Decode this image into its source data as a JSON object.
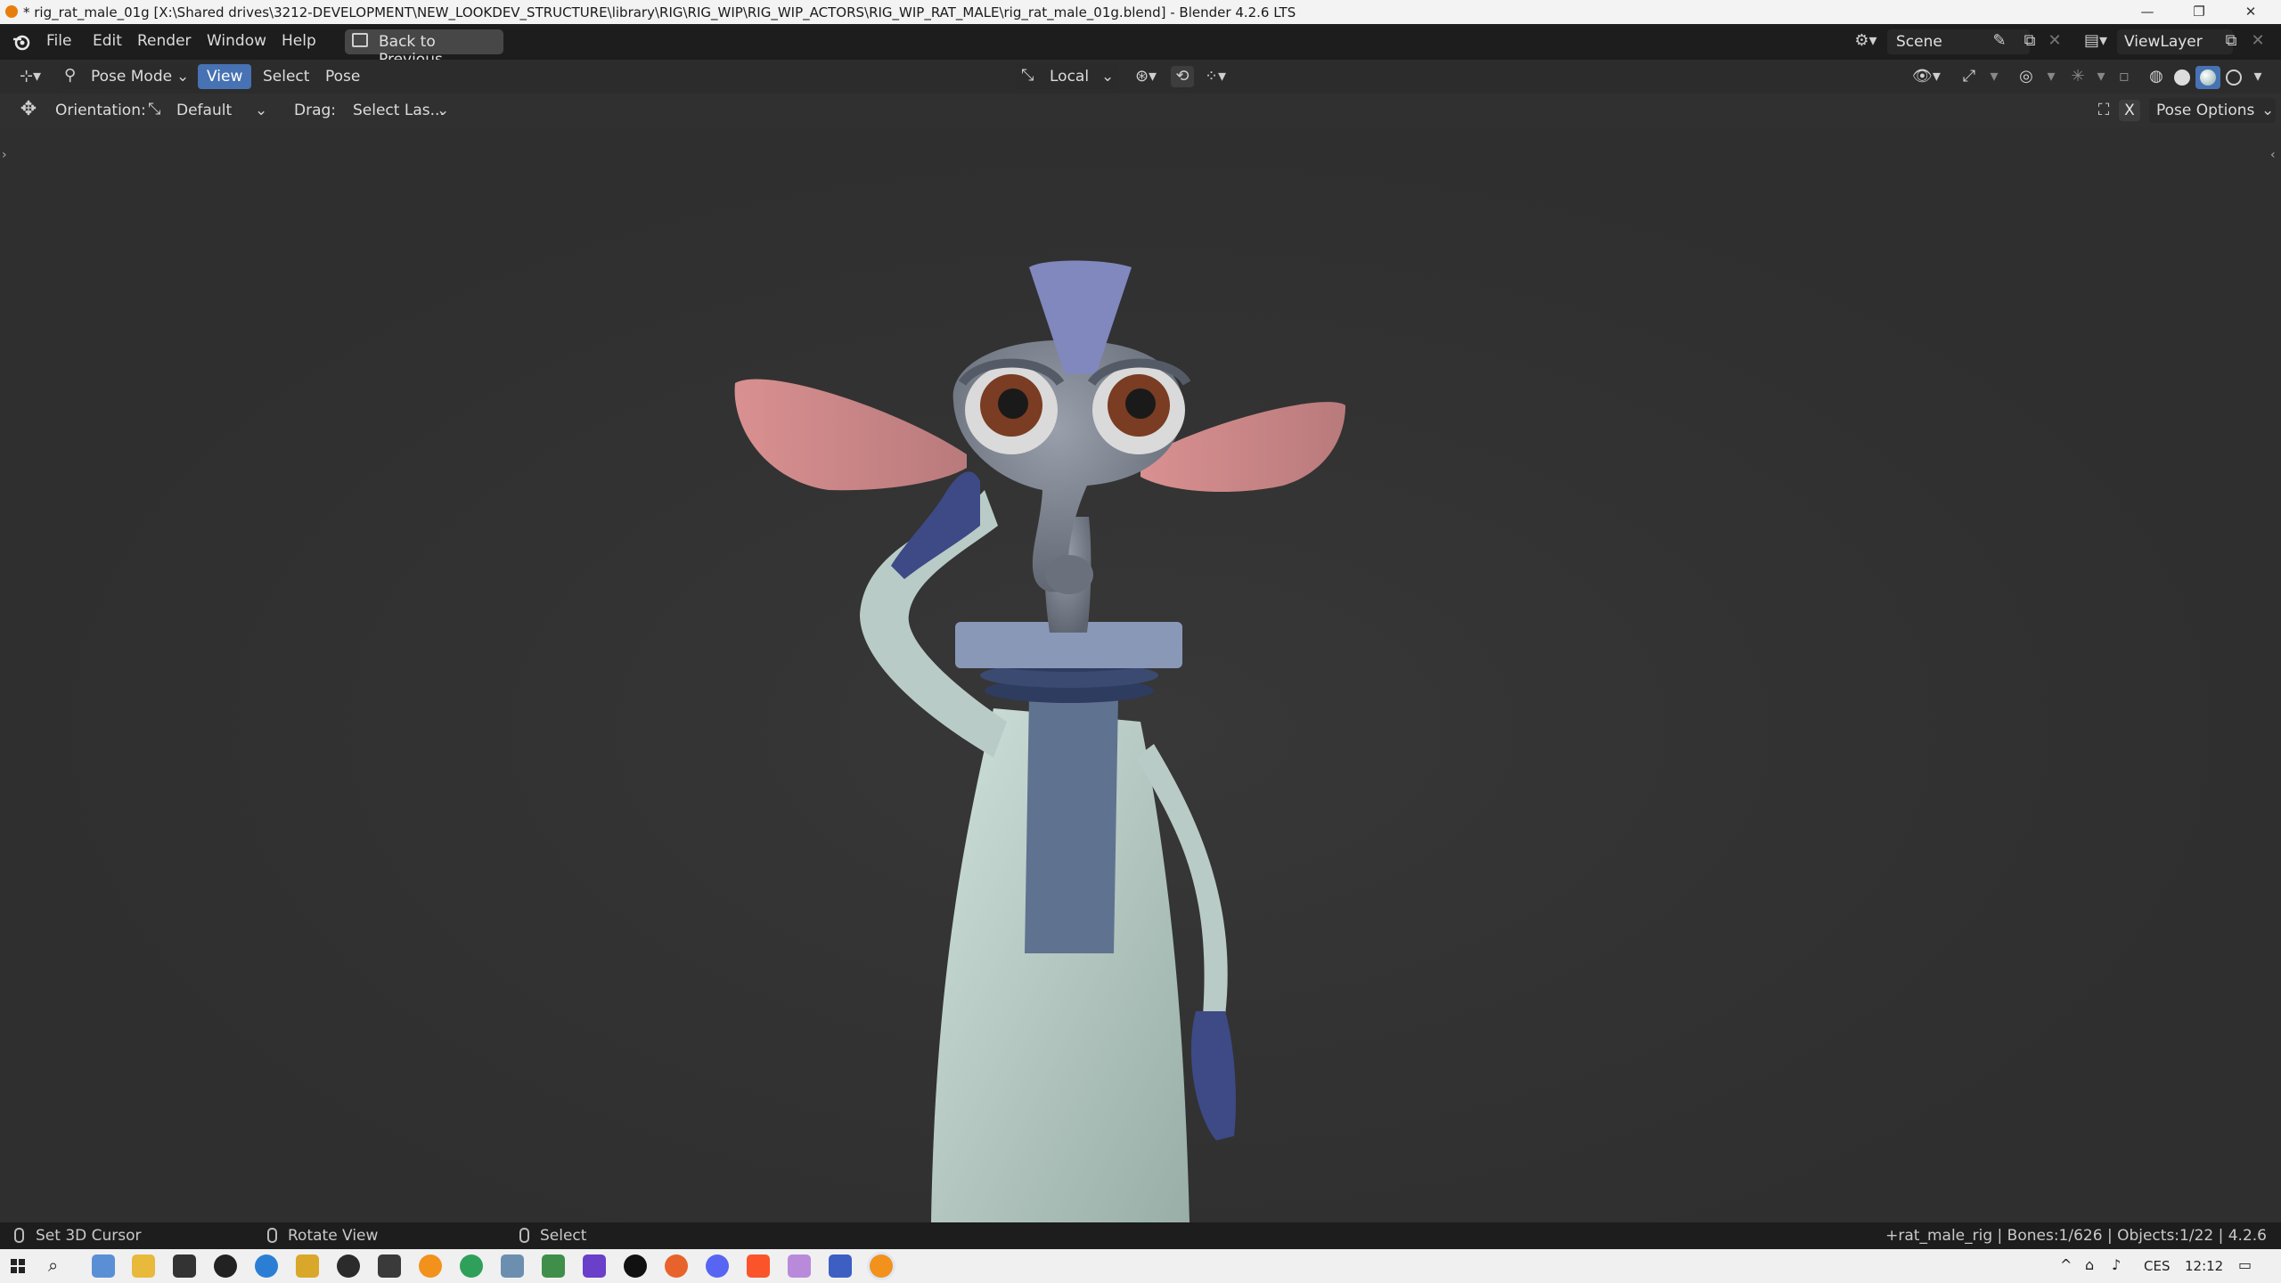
{
  "window": {
    "title": "* rig_rat_male_01g [X:\\Shared drives\\3212-DEVELOPMENT\\NEW_LOOKDEV_STRUCTURE\\library\\RIG\\RIG_WIP\\RIG_WIP_ACTORS\\RIG_WIP_RAT_MALE\\rig_rat_male_01g.blend] - Blender 4.2.6 LTS",
    "minimize": "—",
    "restore": "❐",
    "close": "✕"
  },
  "topbar": {
    "menus": [
      "File",
      "Edit",
      "Render",
      "Window",
      "Help"
    ],
    "back_label": "Back to Previous",
    "scene_label": "Scene",
    "viewlayer_label": "ViewLayer"
  },
  "header": {
    "mode_label": "Pose Mode",
    "menus": [
      "View",
      "Select",
      "Pose"
    ],
    "active_menu": "View",
    "transform_orientation": "Local"
  },
  "tool_settings": {
    "orientation_label": "Orientation:",
    "orientation_value": "Default",
    "drag_label": "Drag:",
    "drag_value": "Select Las...",
    "pose_options_label": "Pose Options",
    "x_label": "X"
  },
  "statusbar": {
    "left": [
      "Set 3D Cursor",
      "Rotate View",
      "Select"
    ],
    "info": "+rat_male_rig | Bones:1/626 | Objects:1/22 | 4.2.6"
  },
  "taskbar": {
    "lang": "CES",
    "time": "12:12"
  },
  "colors": {
    "accent": "#4772b3",
    "viewport_bg": "#303030",
    "topbar": "#1d1d1d"
  }
}
